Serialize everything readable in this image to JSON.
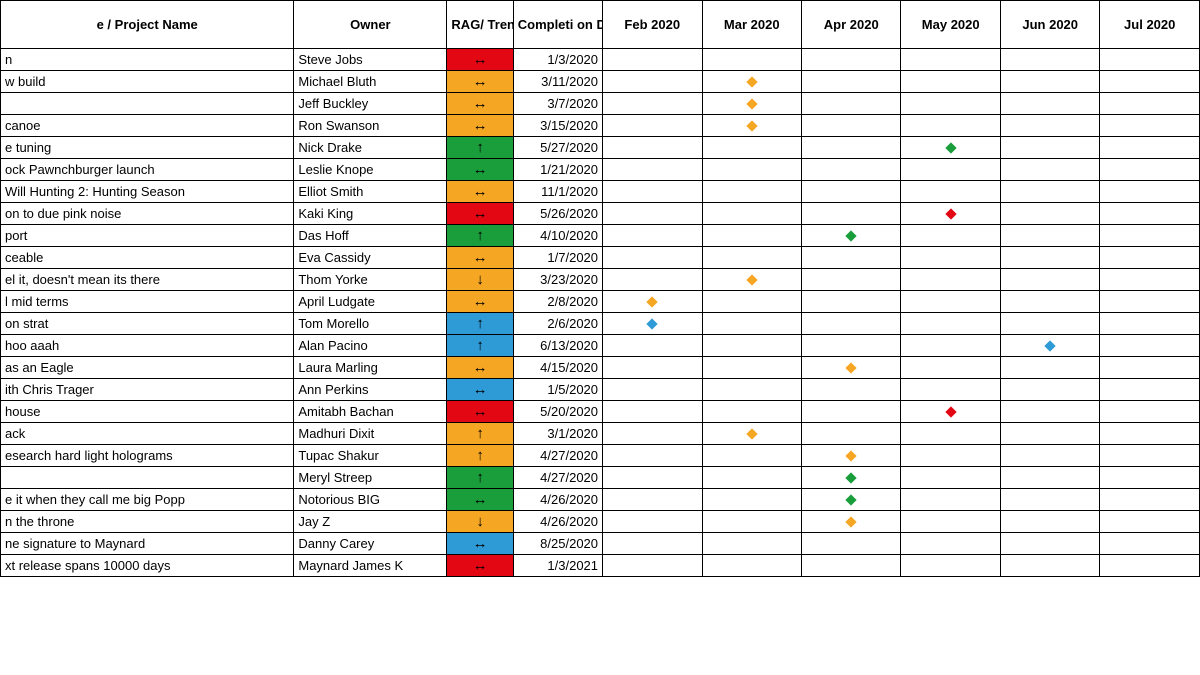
{
  "headers": {
    "project": "e / Project Name",
    "owner": "Owner",
    "rag": "RAG/ Trend",
    "date": "Completi on Date",
    "months": [
      "Feb 2020",
      "Mar 2020",
      "Apr 2020",
      "May 2020",
      "Jun 2020",
      "Jul 2020"
    ]
  },
  "rag_colors": {
    "red": "rag-red",
    "amber": "rag-amber",
    "green": "rag-green",
    "blue": "rag-blue"
  },
  "dot_colors": {
    "red": "dot-red",
    "amber": "dot-amber",
    "green": "dot-green",
    "blue": "dot-blue"
  },
  "trend_glyphs": {
    "up": "↑",
    "down": "↓",
    "flat": "↔"
  },
  "rows": [
    {
      "project": "n",
      "owner": "Steve Jobs",
      "rag": "red",
      "trend": "flat",
      "date": "1/3/2020",
      "dot_month": null,
      "dot_color": null
    },
    {
      "project": "w build",
      "owner": "Michael Bluth",
      "rag": "amber",
      "trend": "flat",
      "date": "3/11/2020",
      "dot_month": 1,
      "dot_color": "amber"
    },
    {
      "project": "",
      "owner": "Jeff Buckley",
      "rag": "amber",
      "trend": "flat",
      "date": "3/7/2020",
      "dot_month": 1,
      "dot_color": "amber"
    },
    {
      "project": "canoe",
      "owner": "Ron Swanson",
      "rag": "amber",
      "trend": "flat",
      "date": "3/15/2020",
      "dot_month": 1,
      "dot_color": "amber"
    },
    {
      "project": "e tuning",
      "owner": "Nick Drake",
      "rag": "green",
      "trend": "up",
      "date": "5/27/2020",
      "dot_month": 3,
      "dot_color": "green"
    },
    {
      "project": "ock Pawnchburger launch",
      "owner": "Leslie Knope",
      "rag": "green",
      "trend": "flat",
      "date": "1/21/2020",
      "dot_month": null,
      "dot_color": null
    },
    {
      "project": "Will Hunting 2: Hunting Season",
      "owner": "Elliot Smith",
      "rag": "amber",
      "trend": "flat",
      "date": "11/1/2020",
      "dot_month": null,
      "dot_color": null
    },
    {
      "project": "on to due pink noise",
      "owner": "Kaki King",
      "rag": "red",
      "trend": "flat",
      "date": "5/26/2020",
      "dot_month": 3,
      "dot_color": "red"
    },
    {
      "project": "port",
      "owner": "Das Hoff",
      "rag": "green",
      "trend": "up",
      "date": "4/10/2020",
      "dot_month": 2,
      "dot_color": "green"
    },
    {
      "project": "ceable",
      "owner": "Eva Cassidy",
      "rag": "amber",
      "trend": "flat",
      "date": "1/7/2020",
      "dot_month": null,
      "dot_color": null
    },
    {
      "project": "el it, doesn't mean its there",
      "owner": "Thom Yorke",
      "rag": "amber",
      "trend": "down",
      "date": "3/23/2020",
      "dot_month": 1,
      "dot_color": "amber"
    },
    {
      "project": "l mid terms",
      "owner": "April Ludgate",
      "rag": "amber",
      "trend": "flat",
      "date": "2/8/2020",
      "dot_month": 0,
      "dot_color": "amber"
    },
    {
      "project": "on strat",
      "owner": "Tom Morello",
      "rag": "blue",
      "trend": "up",
      "date": "2/6/2020",
      "dot_month": 0,
      "dot_color": "blue"
    },
    {
      "project": "hoo aaah",
      "owner": "Alan Pacino",
      "rag": "blue",
      "trend": "up",
      "date": "6/13/2020",
      "dot_month": 4,
      "dot_color": "blue"
    },
    {
      "project": "as an Eagle",
      "owner": "Laura Marling",
      "rag": "amber",
      "trend": "flat",
      "date": "4/15/2020",
      "dot_month": 2,
      "dot_color": "amber"
    },
    {
      "project": "ith Chris Trager",
      "owner": "Ann Perkins",
      "rag": "blue",
      "trend": "flat",
      "date": "1/5/2020",
      "dot_month": null,
      "dot_color": null
    },
    {
      "project": "house",
      "owner": "Amitabh Bachan",
      "rag": "red",
      "trend": "flat",
      "date": "5/20/2020",
      "dot_month": 3,
      "dot_color": "red"
    },
    {
      "project": "ack",
      "owner": "Madhuri Dixit",
      "rag": "amber",
      "trend": "up",
      "date": "3/1/2020",
      "dot_month": 1,
      "dot_color": "amber"
    },
    {
      "project": "esearch hard light holograms",
      "owner": "Tupac Shakur",
      "rag": "amber",
      "trend": "up",
      "date": "4/27/2020",
      "dot_month": 2,
      "dot_color": "amber"
    },
    {
      "project": "",
      "owner": "Meryl Streep",
      "rag": "green",
      "trend": "up",
      "date": "4/27/2020",
      "dot_month": 2,
      "dot_color": "green"
    },
    {
      "project": "e it when they call me big Popp",
      "owner": "Notorious BIG",
      "rag": "green",
      "trend": "flat",
      "date": "4/26/2020",
      "dot_month": 2,
      "dot_color": "green"
    },
    {
      "project": "n the throne",
      "owner": "Jay Z",
      "rag": "amber",
      "trend": "down",
      "date": "4/26/2020",
      "dot_month": 2,
      "dot_color": "amber"
    },
    {
      "project": "ne signature to Maynard",
      "owner": "Danny Carey",
      "rag": "blue",
      "trend": "flat",
      "date": "8/25/2020",
      "dot_month": null,
      "dot_color": null
    },
    {
      "project": "xt release spans 10000 days",
      "owner": "Maynard James K",
      "rag": "red",
      "trend": "flat",
      "date": "1/3/2021",
      "dot_month": null,
      "dot_color": null
    }
  ]
}
